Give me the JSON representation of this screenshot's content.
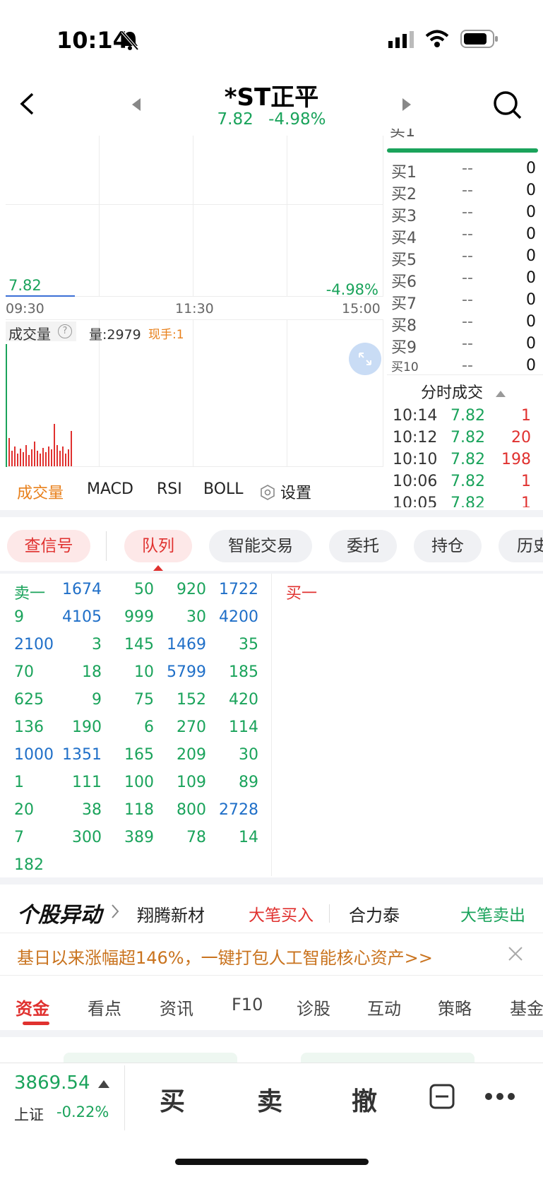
{
  "status": {
    "time": "10:14"
  },
  "header": {
    "title": "*ST正平",
    "price": "7.82",
    "change": "-4.98%"
  },
  "chart": {
    "price_label": "7.82",
    "change_label": "-4.98%",
    "time_ticks": [
      "09:30",
      "11:30",
      "15:00"
    ],
    "volume_label": "成交量",
    "volume_amount": "量:2979",
    "current_hand": "现手:1",
    "volume_bars": [
      40,
      22,
      28,
      18,
      25,
      20,
      30,
      16,
      24,
      35,
      22,
      18,
      26,
      20,
      28,
      24,
      60,
      30,
      22,
      28,
      18,
      24,
      50
    ]
  },
  "order_book": {
    "rows": [
      {
        "label": "买1",
        "price": "--",
        "volume": "0"
      },
      {
        "label": "买2",
        "price": "--",
        "volume": "0"
      },
      {
        "label": "买3",
        "price": "--",
        "volume": "0"
      },
      {
        "label": "买4",
        "price": "--",
        "volume": "0"
      },
      {
        "label": "买5",
        "price": "--",
        "volume": "0"
      },
      {
        "label": "买6",
        "price": "--",
        "volume": "0"
      },
      {
        "label": "买7",
        "price": "--",
        "volume": "0"
      },
      {
        "label": "买8",
        "price": "--",
        "volume": "0"
      },
      {
        "label": "买9",
        "price": "--",
        "volume": "0"
      },
      {
        "label": "买10",
        "price": "--",
        "volume": "0"
      }
    ]
  },
  "tick_trades": {
    "title": "分时成交",
    "rows": [
      {
        "time": "10:14",
        "price": "7.82",
        "volume": "1"
      },
      {
        "time": "10:12",
        "price": "7.82",
        "volume": "20"
      },
      {
        "time": "10:10",
        "price": "7.82",
        "volume": "198"
      },
      {
        "time": "10:06",
        "price": "7.82",
        "volume": "1"
      },
      {
        "time": "10:05",
        "price": "7.82",
        "volume": "1"
      }
    ]
  },
  "indicators": {
    "tabs": [
      "成交量",
      "MACD",
      "RSI",
      "BOLL"
    ],
    "settings": "设置"
  },
  "func_tabs": [
    "查信号",
    "队列",
    "智能交易",
    "委托",
    "持仓",
    "历史"
  ],
  "queue": {
    "sell_label": "卖一",
    "buy_label": "买一",
    "rows": [
      [
        "1674",
        "50",
        "920",
        "1722"
      ],
      [
        "9",
        "4105",
        "999",
        "30",
        "4200"
      ],
      [
        "2100",
        "3",
        "145",
        "1469",
        "35"
      ],
      [
        "70",
        "18",
        "10",
        "5799",
        "185"
      ],
      [
        "625",
        "9",
        "75",
        "152",
        "420"
      ],
      [
        "136",
        "190",
        "6",
        "270",
        "114"
      ],
      [
        "1000",
        "1351",
        "165",
        "209",
        "30"
      ],
      [
        "1",
        "111",
        "100",
        "109",
        "89"
      ],
      [
        "20",
        "38",
        "118",
        "800",
        "2728"
      ],
      [
        "7",
        "300",
        "389",
        "78",
        "14"
      ],
      [
        "182"
      ]
    ]
  },
  "alerts": {
    "title": "个股异动",
    "stock1": "翔腾新材",
    "tag1": "大笔买入",
    "stock2": "合力泰",
    "tag2": "大笔卖出"
  },
  "promo": {
    "text": "基日以来涨幅超146%，一键打包人工智能核心资产>>"
  },
  "bottom_tabs": [
    "资金",
    "看点",
    "资讯",
    "F10",
    "诊股",
    "互动",
    "策略",
    "基金"
  ],
  "index": {
    "value": "3869.54",
    "name": "上证",
    "change": "-0.22%"
  },
  "actions": {
    "buy": "买",
    "sell": "卖",
    "cancel": "撤"
  }
}
